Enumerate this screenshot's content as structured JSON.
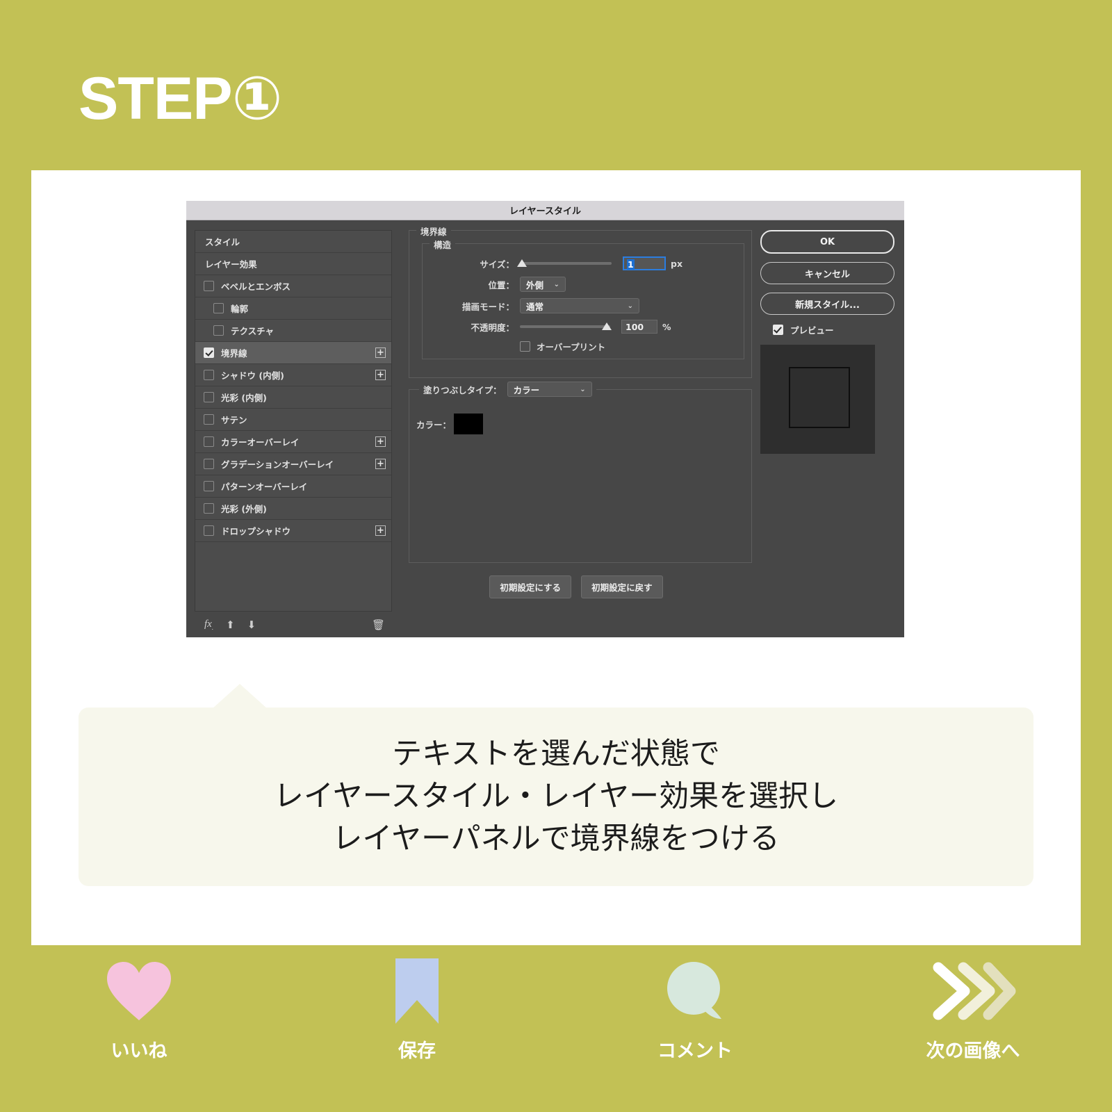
{
  "theme": {
    "brand_olive": "#c2c155",
    "card_white": "#ffffff",
    "bubble_cream": "#f7f7ec",
    "dialog_gray": "#474747",
    "titlebar_gray": "#d7d5d9",
    "accent_blue": "#2b7de0",
    "heart_pink": "#f6c3dd",
    "bookmark_blue": "#bdcdee",
    "comment_mint": "#d7e8dd"
  },
  "banner": {
    "step_label": "STEP①"
  },
  "dialog": {
    "title": "レイヤースタイル",
    "styles_list": [
      {
        "label": "スタイル",
        "type": "header",
        "checked": false,
        "plus": false,
        "indent": false,
        "selected": false
      },
      {
        "label": "レイヤー効果",
        "type": "header",
        "checked": false,
        "plus": false,
        "indent": false,
        "selected": false
      },
      {
        "label": "ベベルとエンボス",
        "type": "item",
        "checked": false,
        "plus": false,
        "indent": false,
        "selected": false
      },
      {
        "label": "輪郭",
        "type": "item",
        "checked": false,
        "plus": false,
        "indent": true,
        "selected": false
      },
      {
        "label": "テクスチャ",
        "type": "item",
        "checked": false,
        "plus": false,
        "indent": true,
        "selected": false
      },
      {
        "label": "境界線",
        "type": "item",
        "checked": true,
        "plus": true,
        "indent": false,
        "selected": true
      },
      {
        "label": "シャドウ (内側)",
        "type": "item",
        "checked": false,
        "plus": true,
        "indent": false,
        "selected": false
      },
      {
        "label": "光彩 (内側)",
        "type": "item",
        "checked": false,
        "plus": false,
        "indent": false,
        "selected": false
      },
      {
        "label": "サテン",
        "type": "item",
        "checked": false,
        "plus": false,
        "indent": false,
        "selected": false
      },
      {
        "label": "カラーオーバーレイ",
        "type": "item",
        "checked": false,
        "plus": true,
        "indent": false,
        "selected": false
      },
      {
        "label": "グラデーションオーバーレイ",
        "type": "item",
        "checked": false,
        "plus": true,
        "indent": false,
        "selected": false
      },
      {
        "label": "パターンオーバーレイ",
        "type": "item",
        "checked": false,
        "plus": false,
        "indent": false,
        "selected": false
      },
      {
        "label": "光彩 (外側)",
        "type": "item",
        "checked": false,
        "plus": false,
        "indent": false,
        "selected": false
      },
      {
        "label": "ドロップシャドウ",
        "type": "item",
        "checked": false,
        "plus": true,
        "indent": false,
        "selected": false
      }
    ],
    "list_toolbar": {
      "fx_icon": "fx-icon",
      "up_icon": "arrow-up-icon",
      "down_icon": "arrow-down-icon",
      "trash_icon": "trash-icon"
    },
    "border_section": {
      "legend": "境界線",
      "structure_legend": "構造",
      "size_label": "サイズ：",
      "size_value": "1",
      "size_unit": "px",
      "position_label": "位置：",
      "position_value": "外側",
      "blend_label": "描画モード：",
      "blend_value": "通常",
      "opacity_label": "不透明度：",
      "opacity_value": "100",
      "opacity_unit": "%",
      "overprint_label": "オーバープリント",
      "overprint_checked": false
    },
    "fill_section": {
      "fill_type_label": "塗りつぶしタイプ：",
      "fill_type_value": "カラー",
      "color_label": "カラー：",
      "color_value": "#000000"
    },
    "default_buttons": {
      "make_default": "初期設定にする",
      "reset_default": "初期設定に戻す"
    },
    "actions": {
      "ok": "OK",
      "cancel": "キャンセル",
      "new_style": "新規スタイル...",
      "preview_label": "プレビュー",
      "preview_checked": true
    }
  },
  "caption": {
    "lines": [
      "テキストを選んだ状態で",
      "レイヤースタイル・レイヤー効果を選択し",
      "レイヤーパネルで境界線をつける"
    ]
  },
  "footer": {
    "items": [
      {
        "label": "いいね",
        "icon": "heart-icon"
      },
      {
        "label": "保存",
        "icon": "bookmark-icon"
      },
      {
        "label": "コメント",
        "icon": "comment-icon"
      },
      {
        "label": "次の画像へ",
        "icon": "chevrons-right-icon"
      }
    ]
  }
}
